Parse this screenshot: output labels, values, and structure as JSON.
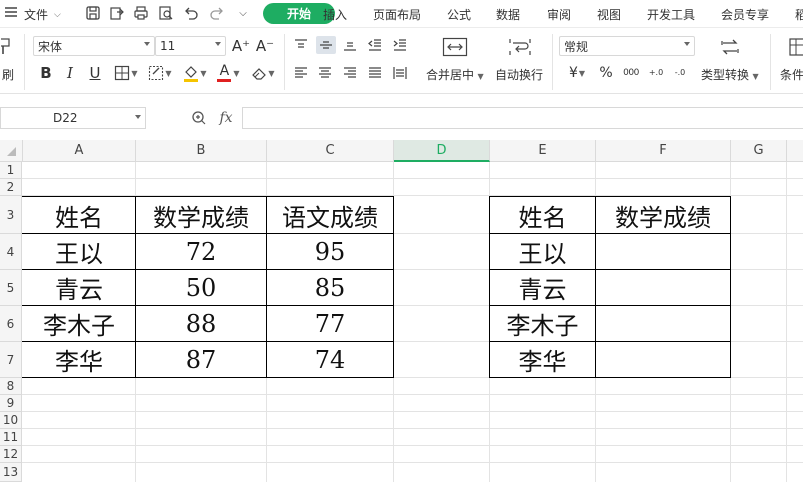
{
  "menubar": {
    "file_label": "文件",
    "tabs": [
      "开始",
      "插入",
      "页面布局",
      "公式",
      "数据",
      "审阅",
      "视图",
      "开发工具",
      "会员专享",
      "稻"
    ],
    "active_color": "#1ead62"
  },
  "ribbon": {
    "format_painter_label": "刷",
    "font_name": "宋体",
    "font_size": "11",
    "merge_label": "合并居中",
    "wrap_label": "自动换行",
    "number_format": "常规",
    "type_convert_label": "类型转换",
    "cond_label": "条件",
    "currency_symbol": "¥",
    "percent_symbol": "%",
    "thousands_symbol": "000",
    "font_color": "#e02020",
    "fill_color": "#f5c400",
    "bold_label": "B",
    "italic_label": "I",
    "underline_label": "U",
    "font_grow_label": "A⁺",
    "font_shrink_label": "A⁻",
    "font_color_label": "A",
    "decimal_inc_label": "+.0",
    "decimal_dec_label": "-.0"
  },
  "formula_bar": {
    "cell_ref": "D22",
    "fx_label": "fx",
    "formula": ""
  },
  "sheet": {
    "columns": [
      "A",
      "B",
      "C",
      "D",
      "E",
      "F",
      "G"
    ],
    "selected_column": "D",
    "rows": [
      "1",
      "2",
      "3",
      "4",
      "5",
      "6",
      "7",
      "8",
      "9",
      "10",
      "11",
      "12",
      "13"
    ],
    "table1": {
      "headers": [
        "姓名",
        "数学成绩",
        "语文成绩"
      ],
      "rows": [
        [
          "王以",
          "72",
          "95"
        ],
        [
          "青云",
          "50",
          "85"
        ],
        [
          "李木子",
          "88",
          "77"
        ],
        [
          "李华",
          "87",
          "74"
        ]
      ]
    },
    "table2": {
      "headers": [
        "姓名",
        "数学成绩"
      ],
      "rows": [
        [
          "王以",
          ""
        ],
        [
          "青云",
          ""
        ],
        [
          "李木子",
          ""
        ],
        [
          "李华",
          ""
        ]
      ]
    }
  }
}
